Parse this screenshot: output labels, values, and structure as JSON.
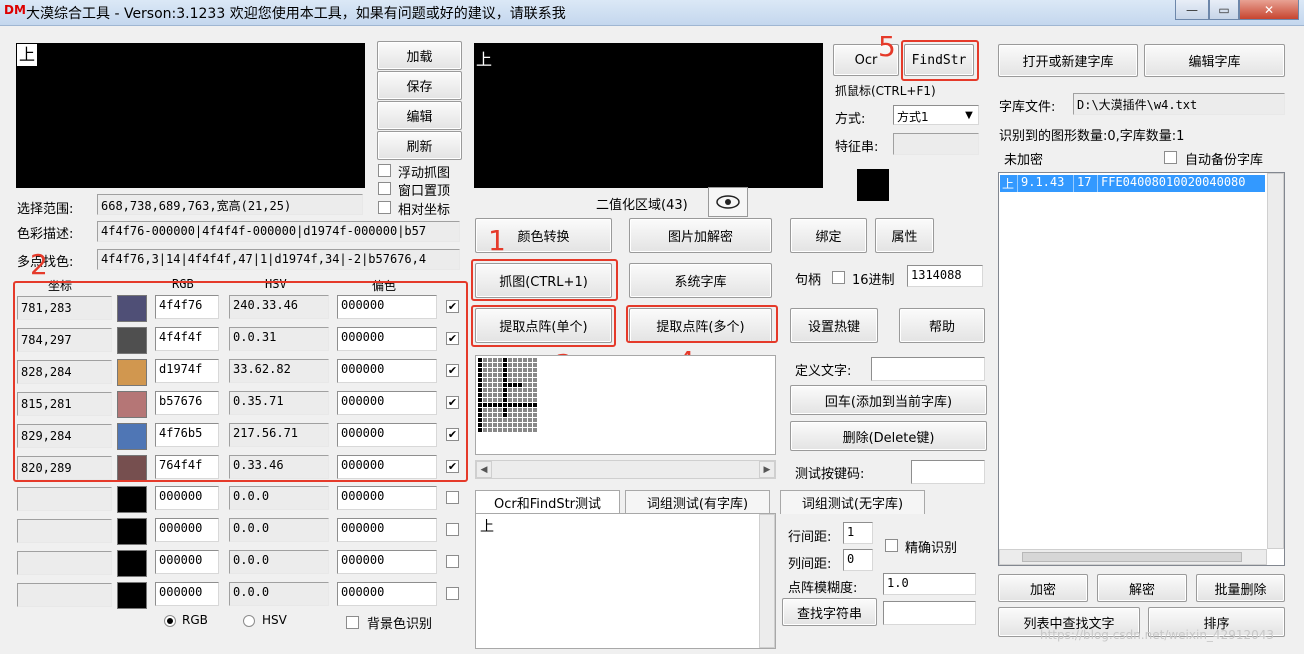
{
  "window": {
    "logo": "DM",
    "title": "大漠综合工具 - Verson:3.1233 欢迎您使用本工具，如果有问题或好的建议，请联系我",
    "btn_min": "—",
    "btn_max": "▭",
    "btn_close": "✕"
  },
  "capture": {
    "preview_char": "上",
    "buttons": {
      "load": "加载",
      "save": "保存",
      "edit": "编辑",
      "refresh": "刷新"
    },
    "checks": {
      "float": "浮动抓图",
      "topmost": "窗口置顶",
      "relative": "相对坐标"
    },
    "range_label": "选择范围:",
    "range_value": "668,738,689,763,宽高(21,25)",
    "color_desc_label": "色彩描述:",
    "color_desc_value": "4f4f76-000000|4f4f4f-000000|d1974f-000000|b57",
    "multi_label": "多点找色:",
    "multi_value": "4f4f76,3|14|4f4f4f,47|1|d1974f,34|-2|b57676,4"
  },
  "color_table": {
    "headers": {
      "coord": "坐标",
      "rgb": "RGB",
      "hsv": "HSV",
      "offset": "偏色"
    },
    "rows": [
      {
        "coord": "781,283",
        "color": "#4f4f76",
        "rgb": "4f4f76",
        "hsv": "240.33.46",
        "offset": "000000",
        "checked": true
      },
      {
        "coord": "784,297",
        "color": "#4f4f4f",
        "rgb": "4f4f4f",
        "hsv": "0.0.31",
        "offset": "000000",
        "checked": true
      },
      {
        "coord": "828,284",
        "color": "#d1974f",
        "rgb": "d1974f",
        "hsv": "33.62.82",
        "offset": "000000",
        "checked": true
      },
      {
        "coord": "815,281",
        "color": "#b57676",
        "rgb": "b57676",
        "hsv": "0.35.71",
        "offset": "000000",
        "checked": true
      },
      {
        "coord": "829,284",
        "color": "#4f76b5",
        "rgb": "4f76b5",
        "hsv": "217.56.71",
        "offset": "000000",
        "checked": true
      },
      {
        "coord": "820,289",
        "color": "#764f4f",
        "rgb": "764f4f",
        "hsv": "0.33.46",
        "offset": "000000",
        "checked": true
      },
      {
        "coord": "",
        "color": "#000000",
        "rgb": "000000",
        "hsv": "0.0.0",
        "offset": "000000",
        "checked": false
      },
      {
        "coord": "",
        "color": "#000000",
        "rgb": "000000",
        "hsv": "0.0.0",
        "offset": "000000",
        "checked": false
      },
      {
        "coord": "",
        "color": "#000000",
        "rgb": "000000",
        "hsv": "0.0.0",
        "offset": "000000",
        "checked": false
      },
      {
        "coord": "",
        "color": "#000000",
        "rgb": "000000",
        "hsv": "0.0.0",
        "offset": "000000",
        "checked": false
      }
    ],
    "radio_rgb": "RGB",
    "radio_hsv": "HSV",
    "bg_check": "背景色识别"
  },
  "binary": {
    "preview_char": "上",
    "label": "二值化区域(43)",
    "eye_icon": "eye-icon"
  },
  "actions": {
    "color_convert": "颜色转换",
    "image_decrypt": "图片加解密",
    "capture": "抓图(CTRL+1)",
    "sys_lib": "系统字库",
    "extract_single": "提取点阵(单个)",
    "extract_multi": "提取点阵(多个)"
  },
  "annotations": {
    "n1": "1",
    "n2": "2",
    "n3": "3",
    "n4": "4",
    "n5": "5"
  },
  "test_tabs": {
    "tab1": "Ocr和FindStr测试",
    "tab2": "词组测试(有字库)",
    "tab3": "词组测试(无字库)",
    "text_value": "上"
  },
  "ocr": {
    "ocr_btn": "Ocr",
    "findstr_btn": "FindStr",
    "grab_mouse": "抓鼠标(CTRL+F1)",
    "mode_label": "方式:",
    "mode_value": "方式1",
    "feature_label": "特征串:",
    "bind_btn": "绑定",
    "attr_btn": "属性",
    "handle_label": "句柄",
    "hex_label": "16进制",
    "handle_value": "1314088",
    "hotkey_btn": "设置热键",
    "help_btn": "帮助",
    "define_label": "定义文字:",
    "enter_btn": "回车(添加到当前字库)",
    "delete_btn": "删除(Delete键)",
    "test_key_label": "测试按键码:",
    "line_gap_label": "行间距:",
    "line_gap_value": "1",
    "col_gap_label": "列间距:",
    "col_gap_value": "0",
    "precise_label": "精确识别",
    "fuzzy_label": "点阵模糊度:",
    "fuzzy_value": "1.0",
    "find_btn": "查找字符串"
  },
  "library": {
    "open_btn": "打开或新建字库",
    "edit_btn": "编辑字库",
    "file_label": "字库文件:",
    "file_value": "D:\\大漠插件\\w4.txt",
    "count_text": "识别到的图形数量:0,字库数量:1",
    "encrypt_status": "未加密",
    "auto_backup": "自动备份字库",
    "entry_char": "上",
    "entry_pos": "9.1.43",
    "entry_num": "17",
    "entry_code": "FFE04008010020040080",
    "encrypt_btn": "加密",
    "decrypt_btn": "解密",
    "batch_delete_btn": "批量删除",
    "find_text_btn": "列表中查找文字",
    "sort_btn": "排序"
  },
  "watermark": "https://blog.csdn.net/weixin_42912043"
}
